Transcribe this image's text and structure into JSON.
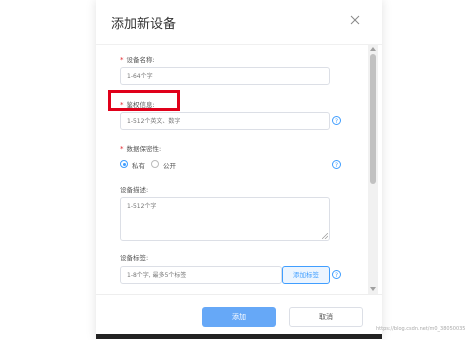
{
  "dialog": {
    "title": "添加新设备",
    "close_icon": "close-icon"
  },
  "form": {
    "name": {
      "required_mark": "*",
      "label": "设备名称:",
      "placeholder": "1-64个字"
    },
    "auth": {
      "required_mark": "*",
      "label": "鉴权信息:",
      "placeholder": "1-512个英文、数字",
      "help_glyph": "?"
    },
    "privacy": {
      "required_mark": "*",
      "label": "数据保密性:",
      "options": [
        {
          "label": "私有",
          "checked": true
        },
        {
          "label": "公开",
          "checked": false
        }
      ],
      "help_glyph": "?"
    },
    "description": {
      "label": "设备描述:",
      "placeholder": "1-512个字"
    },
    "tags": {
      "label": "设备标签:",
      "placeholder": "1-8个字, 最多5个标签",
      "add_button": "添加标签",
      "help_glyph": "?"
    }
  },
  "footer": {
    "submit_label": "添加",
    "cancel_label": "取消"
  },
  "watermark": "https://blog.csdn.net/m0_38050035",
  "colors": {
    "accent": "#409eff",
    "primary_button": "#66a8f7",
    "required": "#e2242b",
    "highlight": "#e0001a"
  }
}
